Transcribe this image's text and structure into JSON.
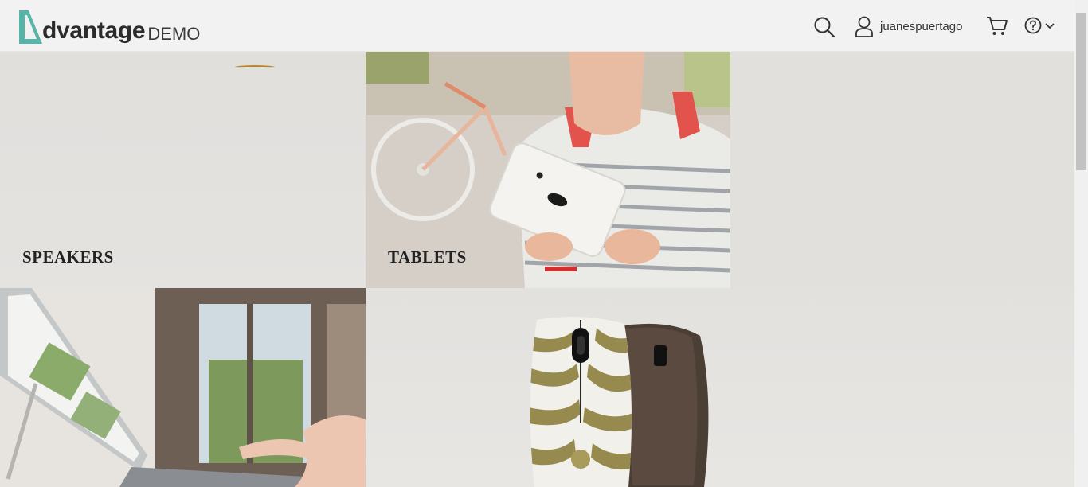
{
  "header": {
    "logo_word": "dvantage",
    "logo_suffix": "DEMO",
    "user_name": "juanespuertago"
  },
  "categories": [
    {
      "label": "SPEAKERS"
    },
    {
      "label": "TABLETS"
    },
    {
      "label": ""
    },
    {
      "label": ""
    }
  ],
  "icons": [
    "search-icon",
    "user-icon",
    "cart-icon",
    "help-icon",
    "chevron-down-icon"
  ],
  "colors": {
    "brand_teal": "#56b4a8",
    "header_bg": "#f2f2f2",
    "text": "#222222"
  }
}
